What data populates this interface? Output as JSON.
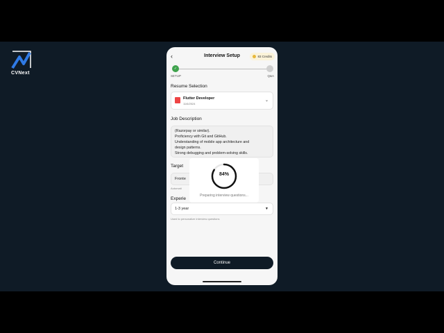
{
  "brand": {
    "name": "CVNext"
  },
  "header": {
    "back_icon": "back-arrow-icon",
    "title": "Interview Setup",
    "credits": "83 Credits"
  },
  "steps": {
    "first": "SETUP",
    "second": "Q&A",
    "done_mark": "✓"
  },
  "resume": {
    "section_label": "Resume Selection",
    "title": "Flutter Developer",
    "date": "11/6/2024"
  },
  "job_description": {
    "section_label": "Job Description",
    "lines": [
      "(Razorpay or similar).",
      "Proficiency with Git and GitHub.",
      "Understanding of mobile app architecture and",
      "design patterns.",
      "Strong debugging and problem-solving skills."
    ]
  },
  "target": {
    "section_label": "Target",
    "value": "Fronte",
    "hint": "Automati"
  },
  "experience": {
    "section_label": "Experie",
    "value": "1-3 year",
    "hint": "Used to personalize interview questions"
  },
  "loading": {
    "progress": 0.84,
    "percent_label": "84%",
    "message": "Preparing interview questions..."
  },
  "footer": {
    "continue_label": "Continue"
  },
  "colors": {
    "accent_dark": "#0f1b26",
    "success": "#3fa34d",
    "credit_dot": "#e8b83a"
  }
}
